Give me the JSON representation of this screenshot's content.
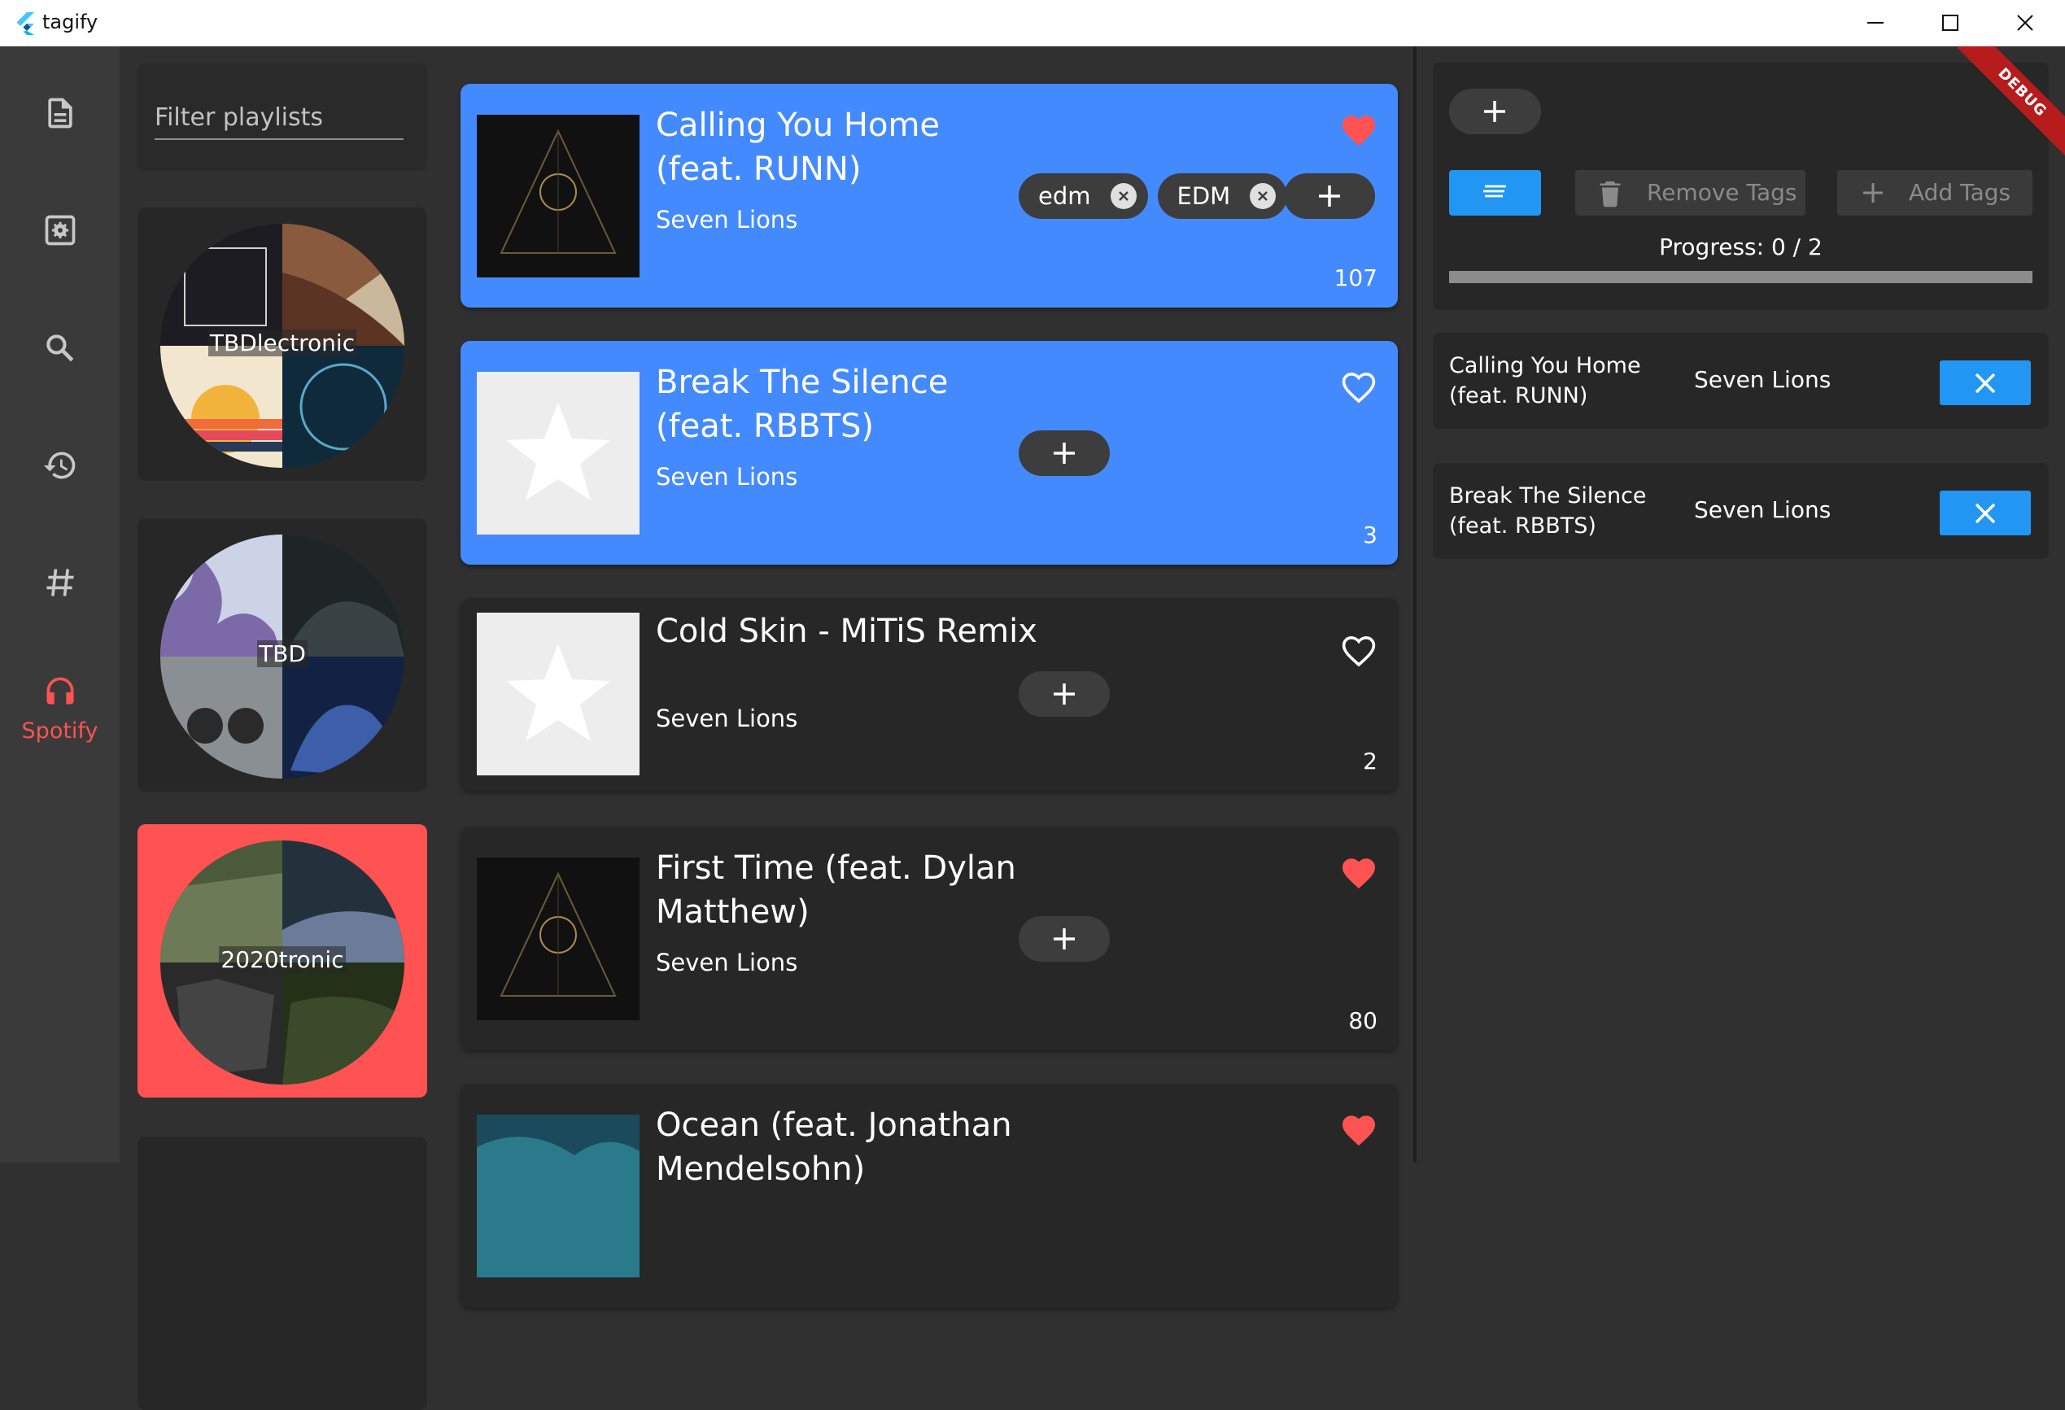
{
  "window": {
    "title": "tagify"
  },
  "nav": {
    "items": [
      {
        "icon": "description-icon"
      },
      {
        "icon": "settings-box-icon"
      },
      {
        "icon": "search-icon"
      },
      {
        "icon": "history-icon"
      },
      {
        "icon": "hashtag-icon"
      },
      {
        "icon": "headphones-icon",
        "label": "Spotify",
        "active": true
      }
    ],
    "accent": "#ff5252"
  },
  "playlists": {
    "filter_placeholder": "Filter playlists",
    "items": [
      {
        "name": "TBDlectronic",
        "selected": false
      },
      {
        "name": "TBD",
        "selected": false
      },
      {
        "name": "2020tronic",
        "selected": true
      }
    ]
  },
  "tracks": [
    {
      "title": "Calling You Home (feat. RUNN)",
      "artist": "Seven Lions",
      "count": "107",
      "liked": true,
      "selected": true,
      "tags": [
        "edm",
        "EDM"
      ],
      "cover": "dark"
    },
    {
      "title": "Break The Silence (feat. RBBTS)",
      "artist": "Seven Lions",
      "count": "3",
      "liked": false,
      "selected": true,
      "tags": [],
      "cover": "placeholder"
    },
    {
      "title": "Cold Skin - MiTiS Remix",
      "artist": "Seven Lions",
      "count": "2",
      "liked": false,
      "selected": false,
      "tags": [],
      "cover": "placeholder"
    },
    {
      "title": "First Time (feat. Dylan Matthew)",
      "artist": "Seven Lions",
      "count": "80",
      "liked": true,
      "selected": false,
      "tags": [],
      "cover": "dark"
    },
    {
      "title": "Ocean (feat. Jonathan Mendelsohn)",
      "artist": "Seven Lions",
      "count": "",
      "liked": true,
      "selected": false,
      "tags": [],
      "cover": "ocean"
    }
  ],
  "panel": {
    "remove_tags_label": "Remove Tags",
    "add_tags_label": "Add Tags",
    "progress_label": "Progress: 0 / 2",
    "progress_fraction": 0,
    "selected": [
      {
        "title": "Calling You Home (feat. RUNN)",
        "artist": "Seven Lions"
      },
      {
        "title": "Break The Silence (feat. RBBTS)",
        "artist": "Seven Lions"
      }
    ],
    "debug_banner": "DEBUG"
  },
  "colors": {
    "selected_track": "#448aff",
    "primary_button": "#2196f3",
    "heart": "#ff5252"
  }
}
